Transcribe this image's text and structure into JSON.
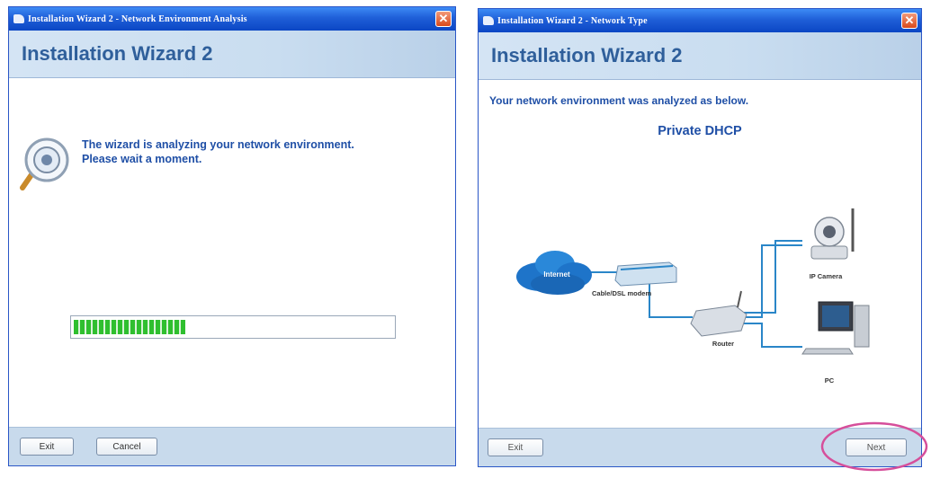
{
  "left_window": {
    "title": "Installation Wizard 2 - Network Environment Analysis",
    "banner_title": "Installation Wizard 2",
    "message_line1": "The wizard is analyzing your network environment.",
    "message_line2": "Please wait a moment.",
    "progress_fraction": 0.35,
    "exit_label": "Exit",
    "cancel_label": "Cancel"
  },
  "right_window": {
    "title": "Installation Wizard 2 - Network Type",
    "banner_title": "Installation Wizard 2",
    "intro": "Your network environment was analyzed as below.",
    "network_type": "Private DHCP",
    "diagram": {
      "internet": "Internet",
      "modem": "Cable/DSL modem",
      "router": "Router",
      "camera": "IP Camera",
      "pc": "PC"
    },
    "exit_label": "Exit",
    "next_label": "Next"
  },
  "colors": {
    "titlebar": "#1f5fd8",
    "banner_text": "#2f5f9b",
    "message_text": "#1f4fa6",
    "progress": "#2fbf2f",
    "highlight_ring": "#d64f9b",
    "diagram_line": "#2a86c8"
  }
}
